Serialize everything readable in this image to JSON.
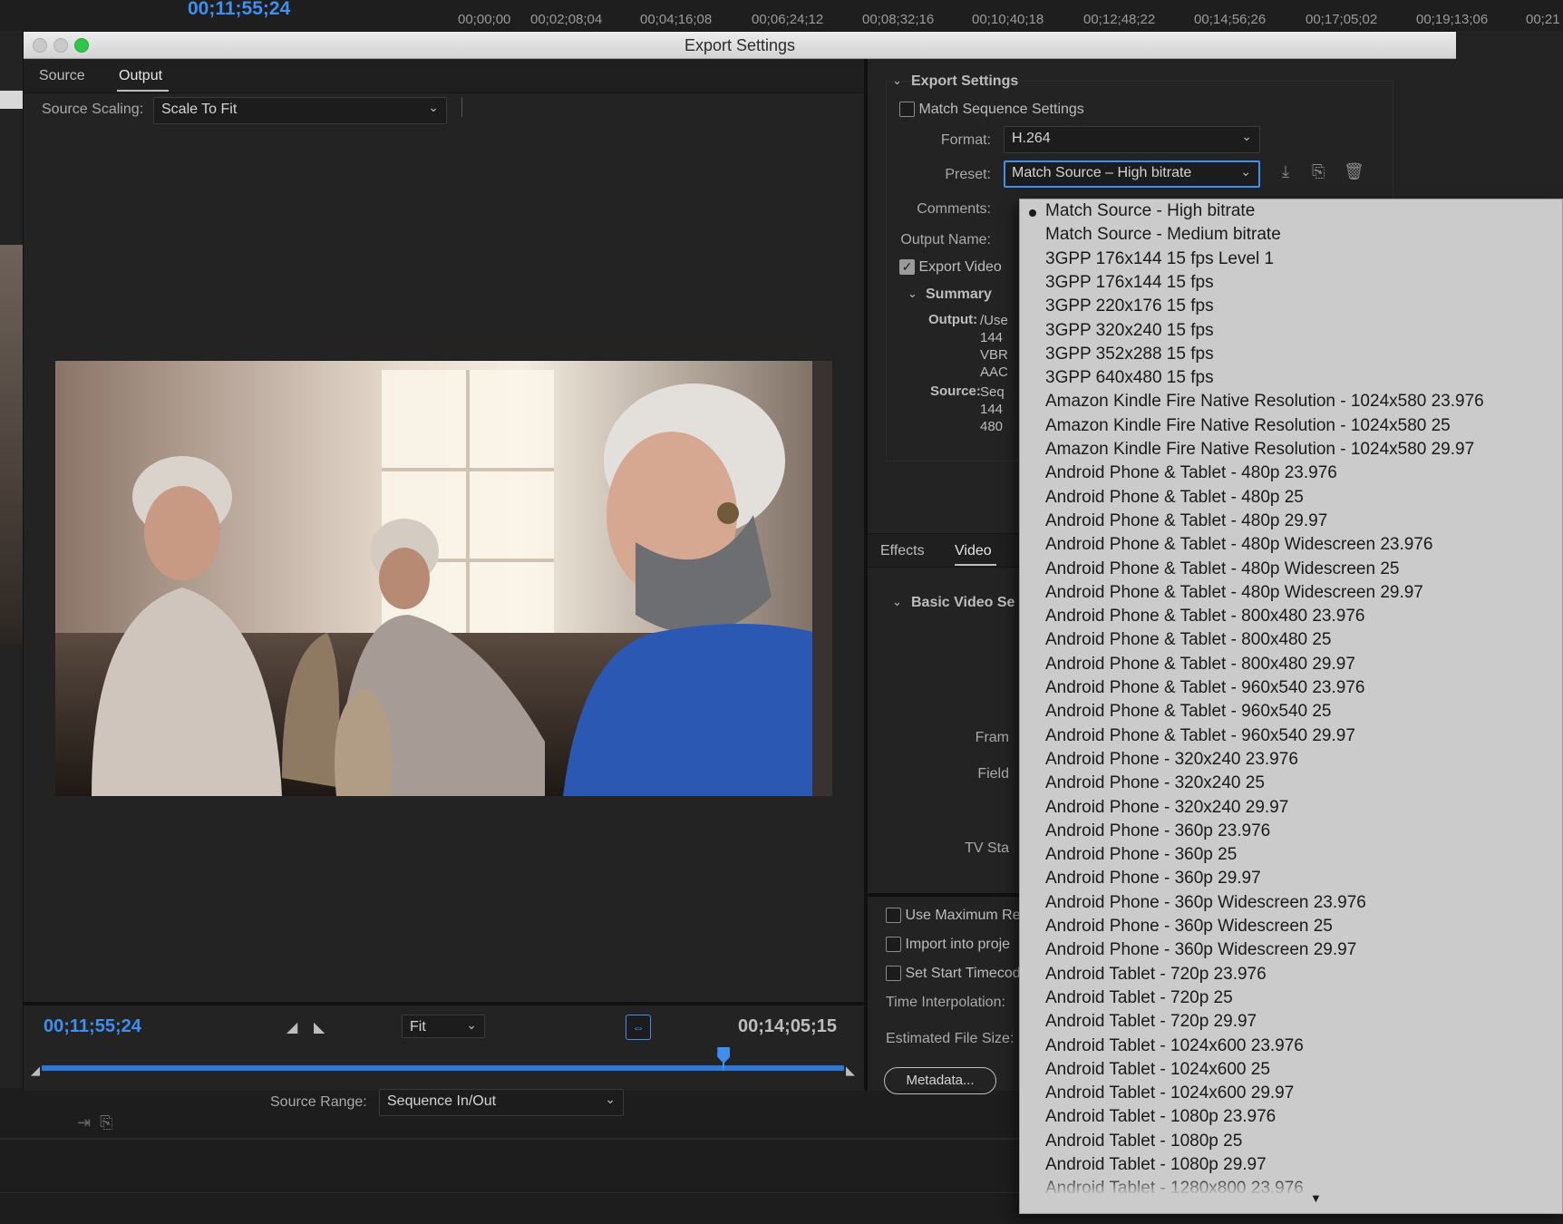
{
  "background": {
    "timecode": "00;11;55;24",
    "ruler": [
      "00;00;00",
      "00;02;08;04",
      "00;04;16;08",
      "00;06;24;12",
      "00;08;32;16",
      "00;10;40;18",
      "00;12;48;22",
      "00;14;56;26",
      "00;17;05;02",
      "00;19;13;06",
      "00;21"
    ]
  },
  "window": {
    "title": "Export Settings"
  },
  "left_panel": {
    "tabs": [
      {
        "label": "Source"
      },
      {
        "label": "Output"
      }
    ],
    "source_scaling_label": "Source Scaling:",
    "source_scaling_value": "Scale To Fit",
    "timecode_current": "00;11;55;24",
    "timecode_duration": "00;14;05;15",
    "zoom_value": "Fit",
    "source_range_label": "Source Range:",
    "source_range_value": "Sequence In/Out",
    "playhead_fraction": 0.85
  },
  "right_panel": {
    "export_settings_head": "Export Settings",
    "match_sequence_label": "Match Sequence Settings",
    "format_label": "Format:",
    "format_value": "H.264",
    "preset_label": "Preset:",
    "preset_value": "Match Source – High bitrate",
    "comments_label": "Comments:",
    "output_name_label": "Output Name:",
    "export_video_label": "Export Video",
    "summary_head": "Summary",
    "summary_output_label": "Output:",
    "summary_output_lines": [
      "/Use",
      "144",
      "VBR",
      "AAC"
    ],
    "summary_source_label": "Source:",
    "summary_source_lines": [
      "Seq",
      "144",
      "480"
    ],
    "tabs": [
      {
        "label": "Effects"
      },
      {
        "label": "Video"
      }
    ],
    "basic_video_head": "Basic Video Se",
    "frame_label": "Fram",
    "field_label": "Field",
    "tv_label": "TV Sta",
    "use_max_label": "Use Maximum Re",
    "import_label": "Import into proje",
    "set_start_label": "Set Start Timecod",
    "time_interp_label": "Time Interpolation:",
    "est_size_label": "Estimated File Size:",
    "metadata_button": "Metadata..."
  },
  "preset_list": {
    "selected_index": 0,
    "items": [
      "Match Source - High bitrate",
      "Match Source - Medium bitrate",
      "3GPP 176x144 15 fps Level 1",
      "3GPP 176x144 15 fps",
      "3GPP 220x176 15 fps",
      "3GPP 320x240 15 fps",
      "3GPP 352x288 15 fps",
      "3GPP 640x480 15 fps",
      "Amazon Kindle Fire Native Resolution - 1024x580 23.976",
      "Amazon Kindle Fire Native Resolution - 1024x580 25",
      "Amazon Kindle Fire Native Resolution - 1024x580 29.97",
      "Android Phone & Tablet - 480p 23.976",
      "Android Phone & Tablet - 480p 25",
      "Android Phone & Tablet - 480p 29.97",
      "Android Phone & Tablet - 480p Widescreen 23.976",
      "Android Phone & Tablet - 480p Widescreen 25",
      "Android Phone & Tablet - 480p Widescreen 29.97",
      "Android Phone & Tablet - 800x480 23.976",
      "Android Phone & Tablet - 800x480 25",
      "Android Phone & Tablet - 800x480 29.97",
      "Android Phone & Tablet - 960x540 23.976",
      "Android Phone & Tablet - 960x540 25",
      "Android Phone & Tablet - 960x540 29.97",
      "Android Phone - 320x240 23.976",
      "Android Phone - 320x240 25",
      "Android Phone - 320x240 29.97",
      "Android Phone - 360p 23.976",
      "Android Phone - 360p 25",
      "Android Phone - 360p 29.97",
      "Android Phone - 360p Widescreen 23.976",
      "Android Phone - 360p Widescreen 25",
      "Android Phone - 360p Widescreen 29.97",
      "Android Tablet - 720p 23.976",
      "Android Tablet - 720p 25",
      "Android Tablet - 720p 29.97",
      "Android Tablet - 1024x600 23.976",
      "Android Tablet - 1024x600 25",
      "Android Tablet - 1024x600 29.97",
      "Android Tablet - 1080p 23.976",
      "Android Tablet - 1080p 25",
      "Android Tablet - 1080p 29.97",
      "Android Tablet - 1280x800 23.976"
    ],
    "more_indicator": "▼"
  },
  "icons": {
    "chevron": "chevron-down-icon",
    "disclosure": "disclosure-triangle-icon",
    "save_preset": "save-preset-icon",
    "import_preset": "import-preset-icon",
    "delete_preset": "trash-icon"
  }
}
